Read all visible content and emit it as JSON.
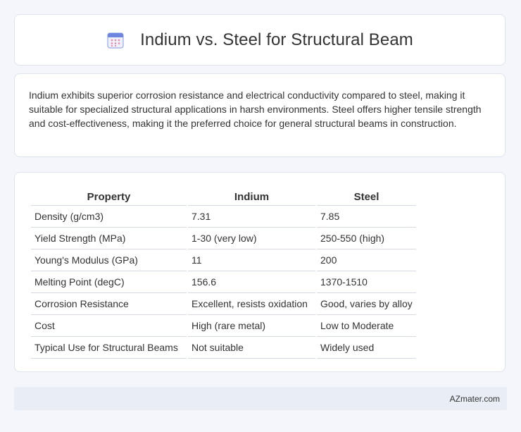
{
  "header": {
    "title": "Indium vs. Steel for Structural Beam",
    "icon": "calendar-icon",
    "icon_color": "#6a7fdb"
  },
  "summary": {
    "text": "Indium exhibits superior corrosion resistance and electrical conductivity compared to steel, making it suitable for specialized structural applications in harsh environments. Steel offers higher tensile strength and cost-effectiveness, making it the preferred choice for general structural beams in construction."
  },
  "table": {
    "headers": [
      "Property",
      "Indium",
      "Steel"
    ],
    "rows": [
      [
        "Density (g/cm3)",
        "7.31",
        "7.85"
      ],
      [
        "Yield Strength (MPa)",
        "1-30 (very low)",
        "250-550 (high)"
      ],
      [
        "Young's Modulus (GPa)",
        "11",
        "200"
      ],
      [
        "Melting Point (degC)",
        "156.6",
        "1370-1510"
      ],
      [
        "Corrosion Resistance",
        "Excellent, resists oxidation",
        "Good, varies by alloy"
      ],
      [
        "Cost",
        "High (rare metal)",
        "Low to Moderate"
      ],
      [
        "Typical Use for Structural Beams",
        "Not suitable",
        "Widely used"
      ]
    ]
  },
  "footer": {
    "brand": "AZmater.com"
  }
}
